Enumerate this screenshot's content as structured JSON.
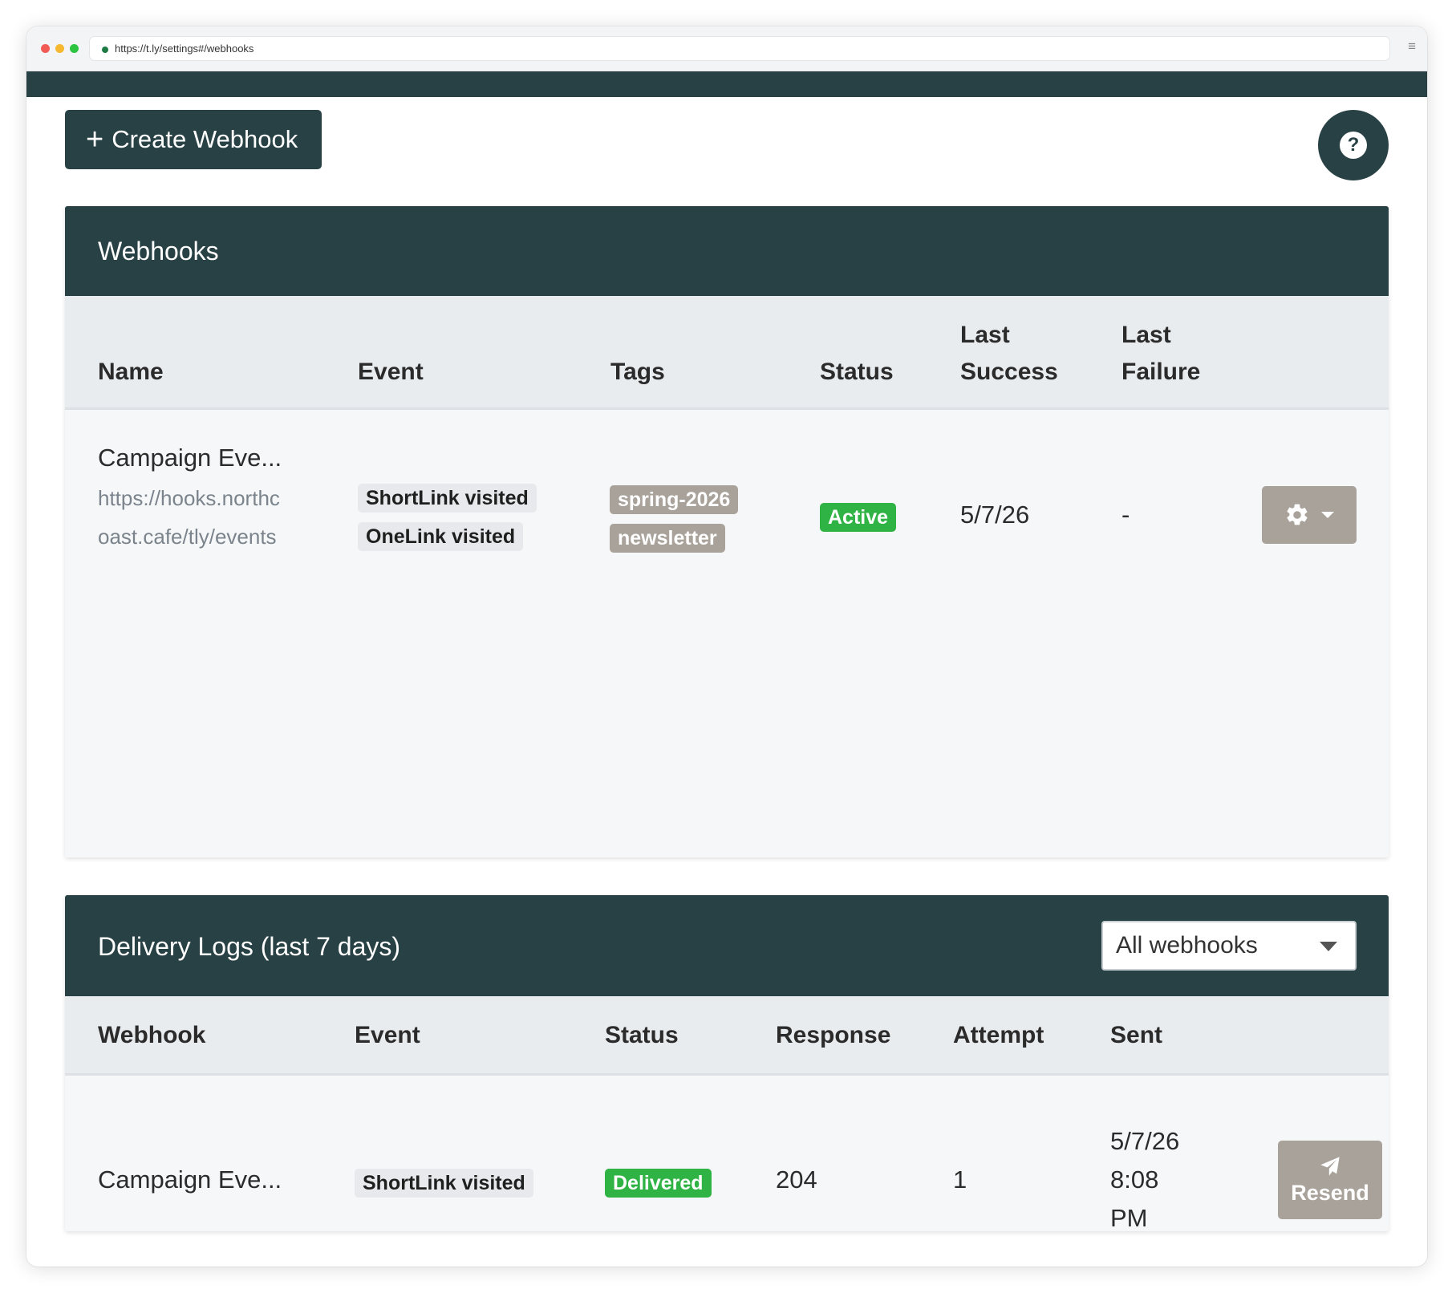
{
  "browser": {
    "url": "https://t.ly/settings#/webhooks",
    "menu_icon": "≡"
  },
  "toolbar": {
    "create_label": "Create Webhook",
    "plus_icon": "+",
    "help_icon": "?"
  },
  "webhooks": {
    "title": "Webhooks",
    "columns": {
      "name": "Name",
      "event": "Event",
      "tags": "Tags",
      "status": "Status",
      "last_success_1": "Last",
      "last_success_2": "Success",
      "last_failure_1": "Last",
      "last_failure_2": "Failure"
    },
    "rows": [
      {
        "name": "Campaign Eve...",
        "url_line_1": "https://hooks.northc",
        "url_line_2": "oast.cafe/tly/events",
        "events": [
          "ShortLink visited",
          "OneLink visited"
        ],
        "tags": [
          "spring-2026",
          "newsletter"
        ],
        "status": "Active",
        "last_success": "5/7/26",
        "last_failure": "-"
      }
    ]
  },
  "logs": {
    "title": "Delivery Logs (last 7 days)",
    "filter_value": "All webhooks",
    "columns": {
      "webhook": "Webhook",
      "event": "Event",
      "status": "Status",
      "response": "Response",
      "attempt": "Attempt",
      "sent": "Sent"
    },
    "rows": [
      {
        "webhook": "Campaign Eve...",
        "event": "ShortLink visited",
        "status": "Delivered",
        "response": "204",
        "attempt": "1",
        "sent_1": "5/7/26",
        "sent_2": "8:08",
        "sent_3": "PM",
        "resend_label": "Resend"
      }
    ]
  },
  "colors": {
    "brand_dark": "#284145",
    "success_green": "#2fb344",
    "tag_gray": "#a8a29b"
  }
}
